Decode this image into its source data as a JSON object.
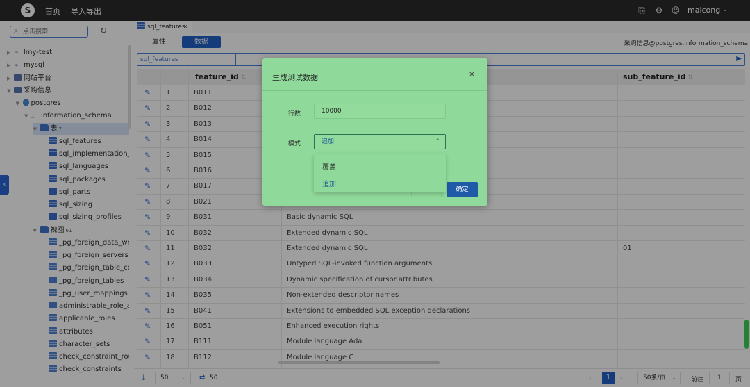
{
  "topbar": {
    "logo_letter": "S",
    "nav": [
      "首页",
      "导入导出"
    ],
    "username": "maicong"
  },
  "sidebar": {
    "search_placeholder": "点击搜索",
    "tree": [
      {
        "label": "lmy-test",
        "icon": "connection-icon",
        "indent": 0
      },
      {
        "label": "mysql",
        "icon": "connection-icon",
        "indent": 0
      },
      {
        "label": "网站平台",
        "icon": "server-icon",
        "indent": 0
      },
      {
        "label": "采购信息",
        "icon": "server-icon",
        "indent": 0
      },
      {
        "label": "postgres",
        "icon": "database-icon",
        "indent": 1
      },
      {
        "label": "information_schema",
        "icon": "schema-icon",
        "indent": 2
      },
      {
        "label": "表",
        "icon": "folder-icon",
        "indent": 3,
        "badge": "7",
        "selected": true
      },
      {
        "label": "sql_features",
        "icon": "table-icon",
        "indent": 4
      },
      {
        "label": "sql_implementation_in",
        "icon": "table-icon",
        "indent": 4
      },
      {
        "label": "sql_languages",
        "icon": "table-icon",
        "indent": 4
      },
      {
        "label": "sql_packages",
        "icon": "table-icon",
        "indent": 4
      },
      {
        "label": "sql_parts",
        "icon": "table-icon",
        "indent": 4
      },
      {
        "label": "sql_sizing",
        "icon": "table-icon",
        "indent": 4
      },
      {
        "label": "sql_sizing_profiles",
        "icon": "table-icon",
        "indent": 4
      },
      {
        "label": "视图",
        "icon": "folder-icon",
        "indent": 3,
        "badge": "61"
      },
      {
        "label": "_pg_foreign_data_wrap",
        "icon": "view-icon",
        "indent": 4
      },
      {
        "label": "_pg_foreign_servers",
        "icon": "view-icon",
        "indent": 4
      },
      {
        "label": "_pg_foreign_table_colu",
        "icon": "view-icon",
        "indent": 4
      },
      {
        "label": "_pg_foreign_tables",
        "icon": "view-icon",
        "indent": 4
      },
      {
        "label": "_pg_user_mappings",
        "icon": "view-icon",
        "indent": 4
      },
      {
        "label": "administrable_role_aut",
        "icon": "view-icon",
        "indent": 4
      },
      {
        "label": "applicable_roles",
        "icon": "view-icon",
        "indent": 4
      },
      {
        "label": "attributes",
        "icon": "view-icon",
        "indent": 4
      },
      {
        "label": "character_sets",
        "icon": "view-icon",
        "indent": 4
      },
      {
        "label": "check_constraint_routi",
        "icon": "view-icon",
        "indent": 4
      },
      {
        "label": "check_constraints",
        "icon": "view-icon",
        "indent": 4
      }
    ]
  },
  "editor": {
    "tab_label": "sql_features",
    "subtabs": [
      "属性",
      "数据"
    ],
    "active_subtab": 1,
    "connection_info": "采购信息@postgres.information_schema",
    "sql_table_name": "sql_features"
  },
  "grid": {
    "columns": [
      "feature_id",
      "sub_feature_id"
    ],
    "rows": [
      {
        "n": "1",
        "id": "B011",
        "name": "",
        "sub": ""
      },
      {
        "n": "2",
        "id": "B012",
        "name": "",
        "sub": ""
      },
      {
        "n": "3",
        "id": "B013",
        "name": "",
        "sub": ""
      },
      {
        "n": "4",
        "id": "B014",
        "name": "",
        "sub": ""
      },
      {
        "n": "5",
        "id": "B015",
        "name": "",
        "sub": ""
      },
      {
        "n": "6",
        "id": "B016",
        "name": "",
        "sub": ""
      },
      {
        "n": "7",
        "id": "B017",
        "name": "",
        "sub": ""
      },
      {
        "n": "8",
        "id": "B021",
        "name": "",
        "sub": ""
      },
      {
        "n": "9",
        "id": "B031",
        "name": "Basic dynamic SQL",
        "sub": ""
      },
      {
        "n": "10",
        "id": "B032",
        "name": "Extended dynamic SQL",
        "sub": ""
      },
      {
        "n": "11",
        "id": "B032",
        "name": "Extended dynamic SQL",
        "sub": "01"
      },
      {
        "n": "12",
        "id": "B033",
        "name": "Untyped SQL-invoked function arguments",
        "sub": ""
      },
      {
        "n": "13",
        "id": "B034",
        "name": "Dynamic specification of cursor attributes",
        "sub": ""
      },
      {
        "n": "14",
        "id": "B035",
        "name": "Non-extended descriptor names",
        "sub": ""
      },
      {
        "n": "15",
        "id": "B041",
        "name": "Extensions to embedded SQL exception declarations",
        "sub": ""
      },
      {
        "n": "16",
        "id": "B051",
        "name": "Enhanced execution rights",
        "sub": ""
      },
      {
        "n": "17",
        "id": "B111",
        "name": "Module language Ada",
        "sub": ""
      },
      {
        "n": "18",
        "id": "B112",
        "name": "Module language C",
        "sub": ""
      }
    ]
  },
  "footer": {
    "limit": "50",
    "refresh_count": "50",
    "current_page": "1",
    "page_size": "50条/页",
    "goto_label": "前往",
    "goto_value": "1",
    "page_unit": "页"
  },
  "modal": {
    "title": "生成测试数据",
    "rows_label": "行数",
    "rows_value": "10000",
    "mode_label": "模式",
    "mode_value": "追加",
    "options": [
      "覆盖",
      "追加"
    ],
    "selected_option": 1,
    "ok_label": "确定"
  },
  "colors": {
    "accent": "#2361c6",
    "modal_bg": "#8fd99a",
    "topbar_bg": "#2b2b2b"
  }
}
